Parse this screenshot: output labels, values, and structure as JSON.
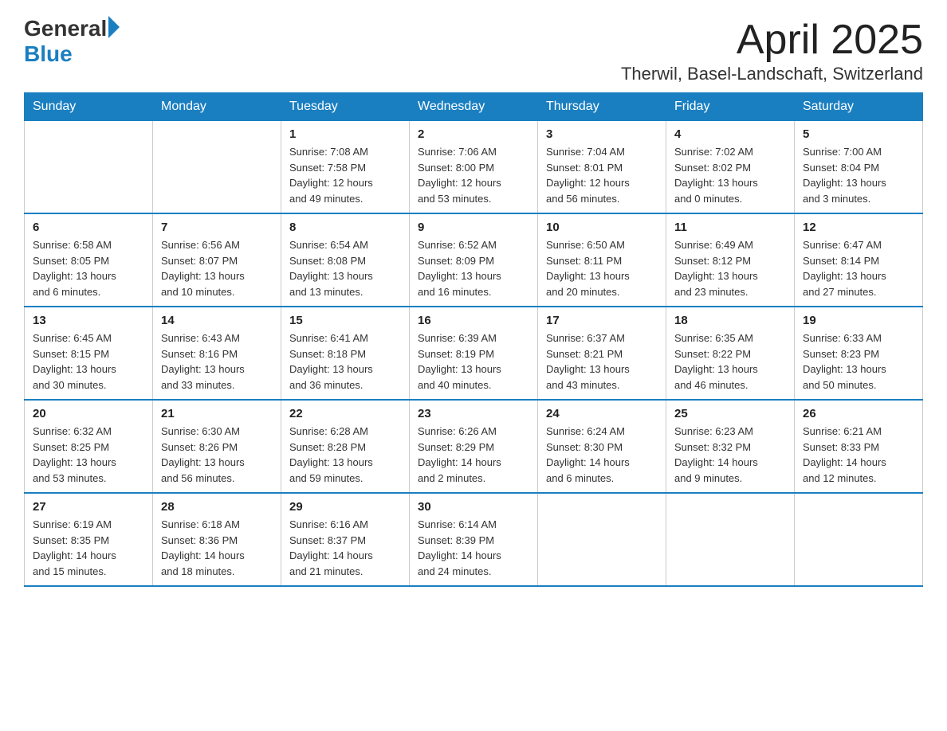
{
  "logo": {
    "general": "General",
    "blue": "Blue"
  },
  "title": "April 2025",
  "location": "Therwil, Basel-Landschaft, Switzerland",
  "headers": [
    "Sunday",
    "Monday",
    "Tuesday",
    "Wednesday",
    "Thursday",
    "Friday",
    "Saturday"
  ],
  "weeks": [
    [
      {
        "day": "",
        "info": ""
      },
      {
        "day": "",
        "info": ""
      },
      {
        "day": "1",
        "info": "Sunrise: 7:08 AM\nSunset: 7:58 PM\nDaylight: 12 hours\nand 49 minutes."
      },
      {
        "day": "2",
        "info": "Sunrise: 7:06 AM\nSunset: 8:00 PM\nDaylight: 12 hours\nand 53 minutes."
      },
      {
        "day": "3",
        "info": "Sunrise: 7:04 AM\nSunset: 8:01 PM\nDaylight: 12 hours\nand 56 minutes."
      },
      {
        "day": "4",
        "info": "Sunrise: 7:02 AM\nSunset: 8:02 PM\nDaylight: 13 hours\nand 0 minutes."
      },
      {
        "day": "5",
        "info": "Sunrise: 7:00 AM\nSunset: 8:04 PM\nDaylight: 13 hours\nand 3 minutes."
      }
    ],
    [
      {
        "day": "6",
        "info": "Sunrise: 6:58 AM\nSunset: 8:05 PM\nDaylight: 13 hours\nand 6 minutes."
      },
      {
        "day": "7",
        "info": "Sunrise: 6:56 AM\nSunset: 8:07 PM\nDaylight: 13 hours\nand 10 minutes."
      },
      {
        "day": "8",
        "info": "Sunrise: 6:54 AM\nSunset: 8:08 PM\nDaylight: 13 hours\nand 13 minutes."
      },
      {
        "day": "9",
        "info": "Sunrise: 6:52 AM\nSunset: 8:09 PM\nDaylight: 13 hours\nand 16 minutes."
      },
      {
        "day": "10",
        "info": "Sunrise: 6:50 AM\nSunset: 8:11 PM\nDaylight: 13 hours\nand 20 minutes."
      },
      {
        "day": "11",
        "info": "Sunrise: 6:49 AM\nSunset: 8:12 PM\nDaylight: 13 hours\nand 23 minutes."
      },
      {
        "day": "12",
        "info": "Sunrise: 6:47 AM\nSunset: 8:14 PM\nDaylight: 13 hours\nand 27 minutes."
      }
    ],
    [
      {
        "day": "13",
        "info": "Sunrise: 6:45 AM\nSunset: 8:15 PM\nDaylight: 13 hours\nand 30 minutes."
      },
      {
        "day": "14",
        "info": "Sunrise: 6:43 AM\nSunset: 8:16 PM\nDaylight: 13 hours\nand 33 minutes."
      },
      {
        "day": "15",
        "info": "Sunrise: 6:41 AM\nSunset: 8:18 PM\nDaylight: 13 hours\nand 36 minutes."
      },
      {
        "day": "16",
        "info": "Sunrise: 6:39 AM\nSunset: 8:19 PM\nDaylight: 13 hours\nand 40 minutes."
      },
      {
        "day": "17",
        "info": "Sunrise: 6:37 AM\nSunset: 8:21 PM\nDaylight: 13 hours\nand 43 minutes."
      },
      {
        "day": "18",
        "info": "Sunrise: 6:35 AM\nSunset: 8:22 PM\nDaylight: 13 hours\nand 46 minutes."
      },
      {
        "day": "19",
        "info": "Sunrise: 6:33 AM\nSunset: 8:23 PM\nDaylight: 13 hours\nand 50 minutes."
      }
    ],
    [
      {
        "day": "20",
        "info": "Sunrise: 6:32 AM\nSunset: 8:25 PM\nDaylight: 13 hours\nand 53 minutes."
      },
      {
        "day": "21",
        "info": "Sunrise: 6:30 AM\nSunset: 8:26 PM\nDaylight: 13 hours\nand 56 minutes."
      },
      {
        "day": "22",
        "info": "Sunrise: 6:28 AM\nSunset: 8:28 PM\nDaylight: 13 hours\nand 59 minutes."
      },
      {
        "day": "23",
        "info": "Sunrise: 6:26 AM\nSunset: 8:29 PM\nDaylight: 14 hours\nand 2 minutes."
      },
      {
        "day": "24",
        "info": "Sunrise: 6:24 AM\nSunset: 8:30 PM\nDaylight: 14 hours\nand 6 minutes."
      },
      {
        "day": "25",
        "info": "Sunrise: 6:23 AM\nSunset: 8:32 PM\nDaylight: 14 hours\nand 9 minutes."
      },
      {
        "day": "26",
        "info": "Sunrise: 6:21 AM\nSunset: 8:33 PM\nDaylight: 14 hours\nand 12 minutes."
      }
    ],
    [
      {
        "day": "27",
        "info": "Sunrise: 6:19 AM\nSunset: 8:35 PM\nDaylight: 14 hours\nand 15 minutes."
      },
      {
        "day": "28",
        "info": "Sunrise: 6:18 AM\nSunset: 8:36 PM\nDaylight: 14 hours\nand 18 minutes."
      },
      {
        "day": "29",
        "info": "Sunrise: 6:16 AM\nSunset: 8:37 PM\nDaylight: 14 hours\nand 21 minutes."
      },
      {
        "day": "30",
        "info": "Sunrise: 6:14 AM\nSunset: 8:39 PM\nDaylight: 14 hours\nand 24 minutes."
      },
      {
        "day": "",
        "info": ""
      },
      {
        "day": "",
        "info": ""
      },
      {
        "day": "",
        "info": ""
      }
    ]
  ]
}
